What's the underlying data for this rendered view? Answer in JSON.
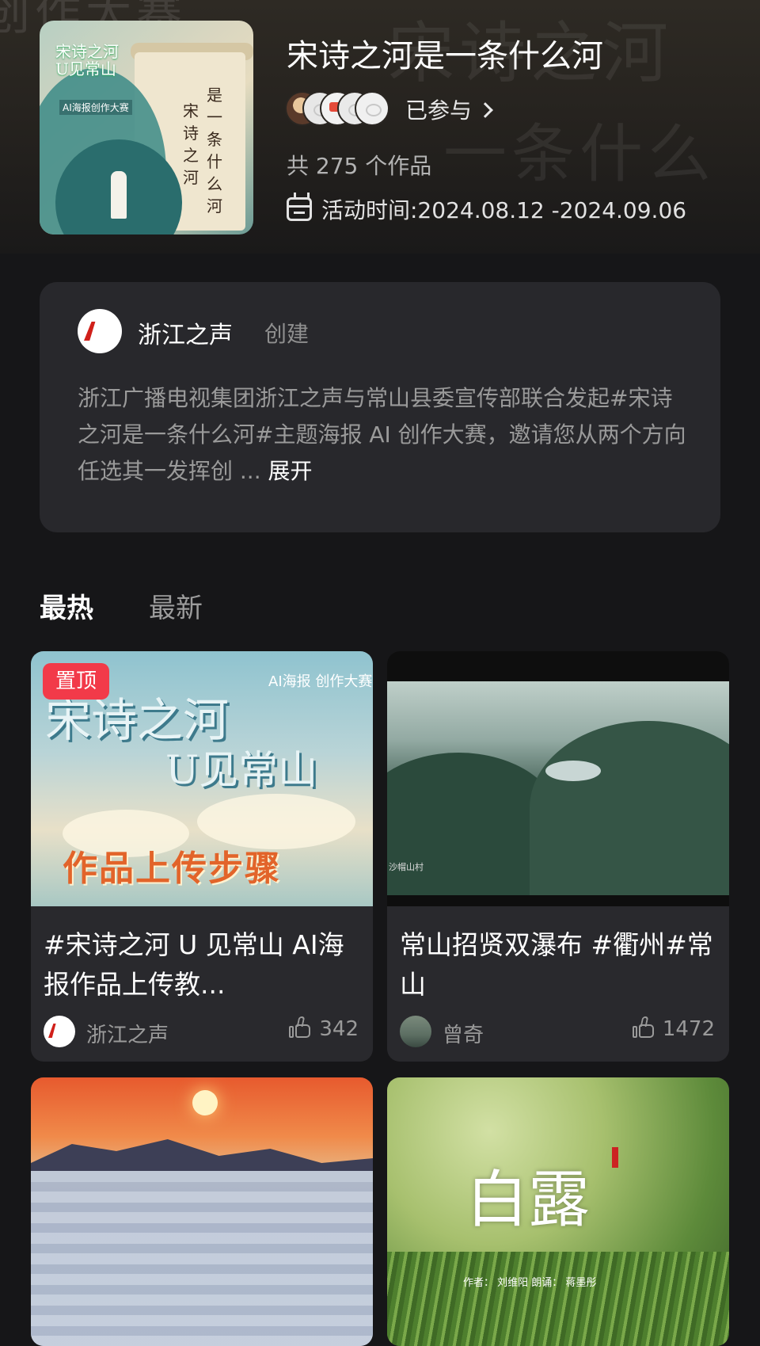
{
  "activity": {
    "title": "宋诗之河是一条什么河",
    "joined_label": "已参与",
    "works_count": "共 275 个作品",
    "time_label": "活动时间:2024.08.12 -2024.09.06",
    "cover_texts": {
      "title_line1": "宋诗之河",
      "title_line2": "U见常山",
      "subtitle": "AI海报创作大赛",
      "col1": "是一条什么河",
      "col2": "宋诗之河"
    },
    "background_watermark": [
      "宋诗之河",
      "一条什么",
      "创作大赛"
    ]
  },
  "creator": {
    "name": "浙江之声",
    "action": "创建",
    "description": "浙江广播电视集团浙江之声与常山县委宣传部联合发起#宋诗之河是一条什么河#主题海报 AI 创作大赛，邀请您从两个方向任选其一发挥创 ...",
    "more_label": "展开"
  },
  "tabs": [
    {
      "label": "最热",
      "active": true
    },
    {
      "label": "最新",
      "active": false
    }
  ],
  "cards": [
    {
      "pinned_label": "置顶",
      "title": "#宋诗之河 U 见常山 AI海报作品上传教...",
      "author": "浙江之声",
      "likes": "342",
      "thumb_texts": {
        "big1": "宋诗之河",
        "big2": "U见常山",
        "ai": "AI海报 创作大赛",
        "step": "作品上传步骤"
      }
    },
    {
      "title": "常山招贤双瀑布 #衢州#常山",
      "author": "曾奇",
      "likes": "1472",
      "thumb_texts": {
        "caption": "沙帽山村"
      }
    },
    {
      "title": "",
      "author": "",
      "likes": ""
    },
    {
      "title": "",
      "author": "",
      "likes": "",
      "thumb_texts": {
        "calli": "白露",
        "auth": "作者： 刘维阳  朗诵： 蒋墨彤"
      }
    }
  ],
  "colors": {
    "background": "#161618",
    "card": "#29292d",
    "pinned_badge": "#f23a49",
    "text_secondary": "#9a9a9a"
  }
}
